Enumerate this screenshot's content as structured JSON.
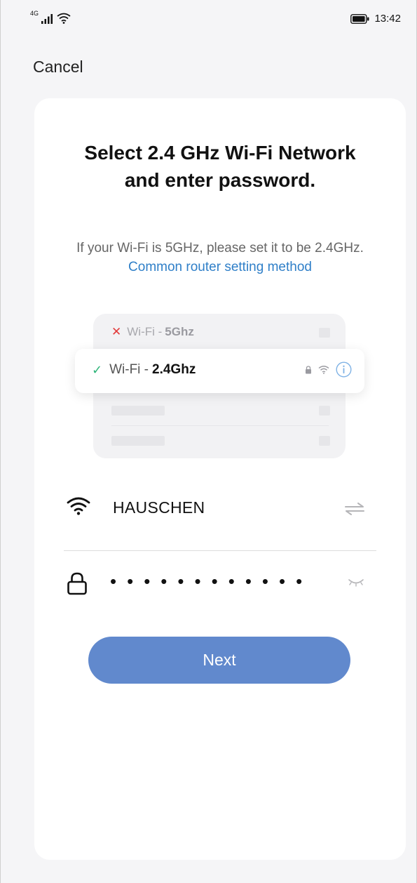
{
  "status_bar": {
    "network": "4G",
    "time": "13:42"
  },
  "nav": {
    "cancel_label": "Cancel"
  },
  "card": {
    "title": "Select 2.4 GHz Wi-Fi Network and enter password.",
    "subtitle_text": "If your Wi-Fi is 5GHz, please set it to be 2.4GHz.",
    "subtitle_link": "Common router setting method"
  },
  "illustration": {
    "row_5g": {
      "prefix": "Wi-Fi -",
      "band": "5Ghz"
    },
    "row_24g": {
      "prefix": "Wi-Fi -",
      "band": "2.4Ghz"
    }
  },
  "form": {
    "ssid_value": "HAUSCHEN",
    "password_masked": "••••••••••••",
    "next_label": "Next"
  },
  "colors": {
    "accent": "#6189cd",
    "link": "#2f7fc8",
    "success": "#2fb57a",
    "error": "#e23b3b"
  }
}
